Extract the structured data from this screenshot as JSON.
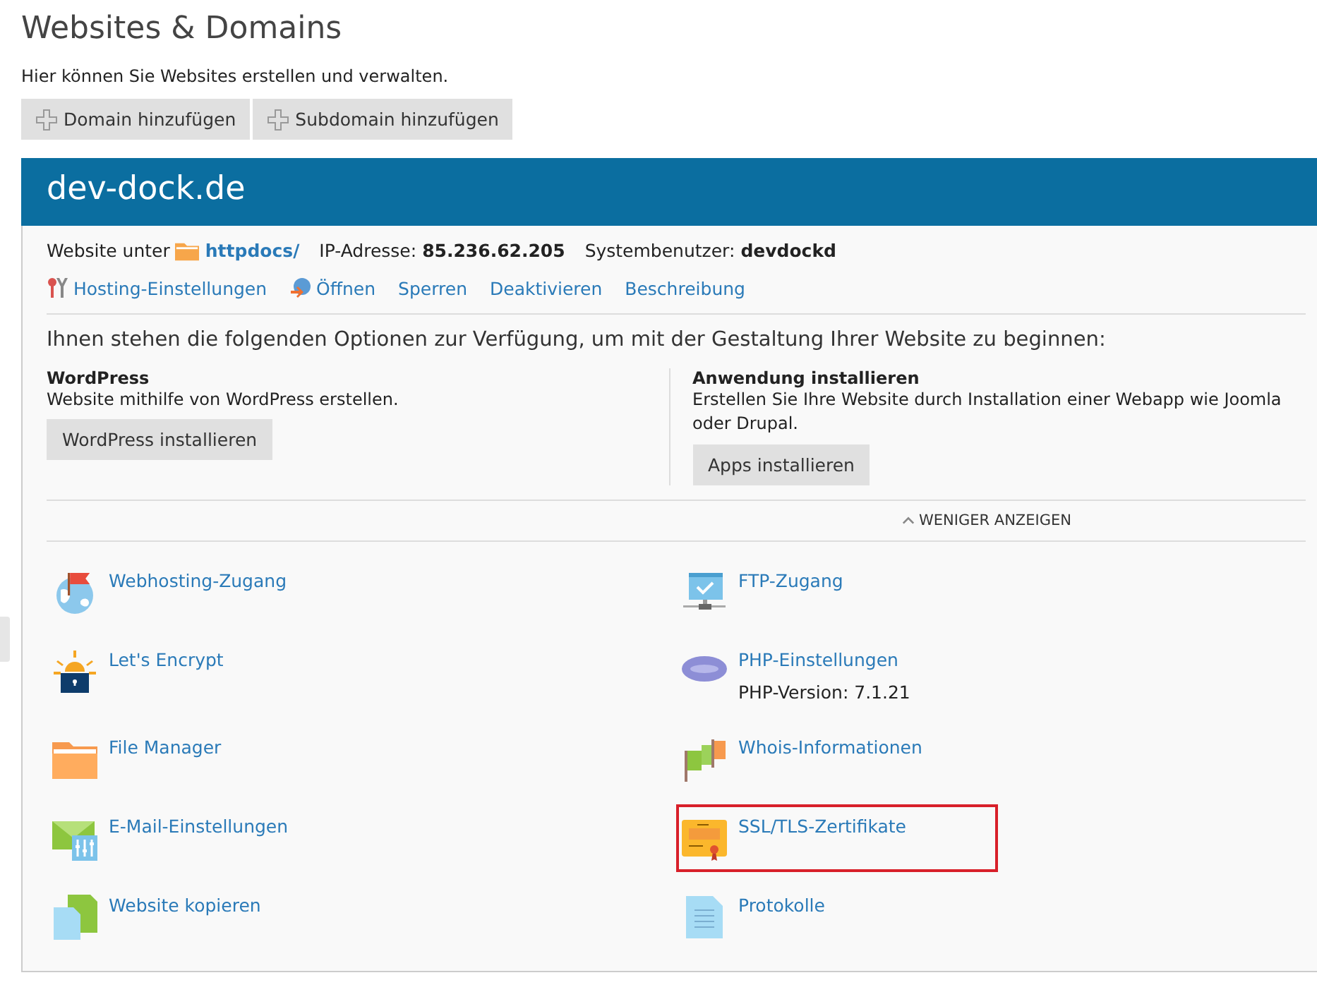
{
  "page": {
    "title": "Websites & Domains",
    "description": "Hier können Sie Websites erstellen und verwalten."
  },
  "toolbar": [
    {
      "label": "Domain hinzufügen"
    },
    {
      "label": "Subdomain hinzufügen"
    }
  ],
  "domain": {
    "name": "dev-dock.de",
    "info": [
      {
        "label": "Website unter",
        "value": "httpdocs/",
        "kind": "folder-link"
      },
      {
        "label": "IP-Adresse:",
        "value": "85.236.62.205",
        "kind": "bold"
      },
      {
        "label": "Systembenutzer:",
        "value": "devdockd",
        "kind": "bold"
      }
    ],
    "actions": [
      {
        "label": "Hosting-Einstellungen",
        "kind": "tools"
      },
      {
        "label": "Öffnen",
        "kind": "globe"
      },
      {
        "label": "Sperren",
        "kind": "plain"
      },
      {
        "label": "Deaktivieren",
        "kind": "plain"
      },
      {
        "label": "Beschreibung",
        "kind": "plain"
      }
    ],
    "intro": "Ihnen stehen die folgenden Optionen zur Verfügung, um mit der Gestaltung Ihrer Website zu beginnen:",
    "options": [
      {
        "title": "WordPress",
        "text": "Website mithilfe von WordPress erstellen.",
        "button": "WordPress installieren"
      },
      {
        "title": "Anwendung installieren",
        "text": "Erstellen Sie Ihre Website durch Installation einer Webapp wie Joomla oder Drupal.",
        "button": "Apps installieren"
      }
    ],
    "toggle": {
      "label": "WENIGER ANZEIGEN",
      "expanded": true
    },
    "tools": [
      {
        "label": "Webhosting-Zugang",
        "kind": "hosting",
        "highlighted": false
      },
      {
        "label": "FTP-Zugang",
        "kind": "ftp",
        "highlighted": false
      },
      {
        "label": "Let's Encrypt",
        "kind": "encrypt",
        "highlighted": false
      },
      {
        "label": "PHP-Einstellungen",
        "kind": "php",
        "note": "PHP-Version: 7.1.21",
        "highlighted": false
      },
      {
        "label": "File Manager",
        "kind": "files",
        "highlighted": false
      },
      {
        "label": "Whois-Informationen",
        "kind": "whois",
        "highlighted": false
      },
      {
        "label": "E-Mail-Einstellungen",
        "kind": "mail",
        "highlighted": false
      },
      {
        "label": "SSL/TLS-Zertifikate",
        "kind": "certificate",
        "highlighted": true
      },
      {
        "label": "Website kopieren",
        "kind": "copy",
        "highlighted": false
      },
      {
        "label": "Protokolle",
        "kind": "log",
        "highlighted": false
      }
    ]
  }
}
